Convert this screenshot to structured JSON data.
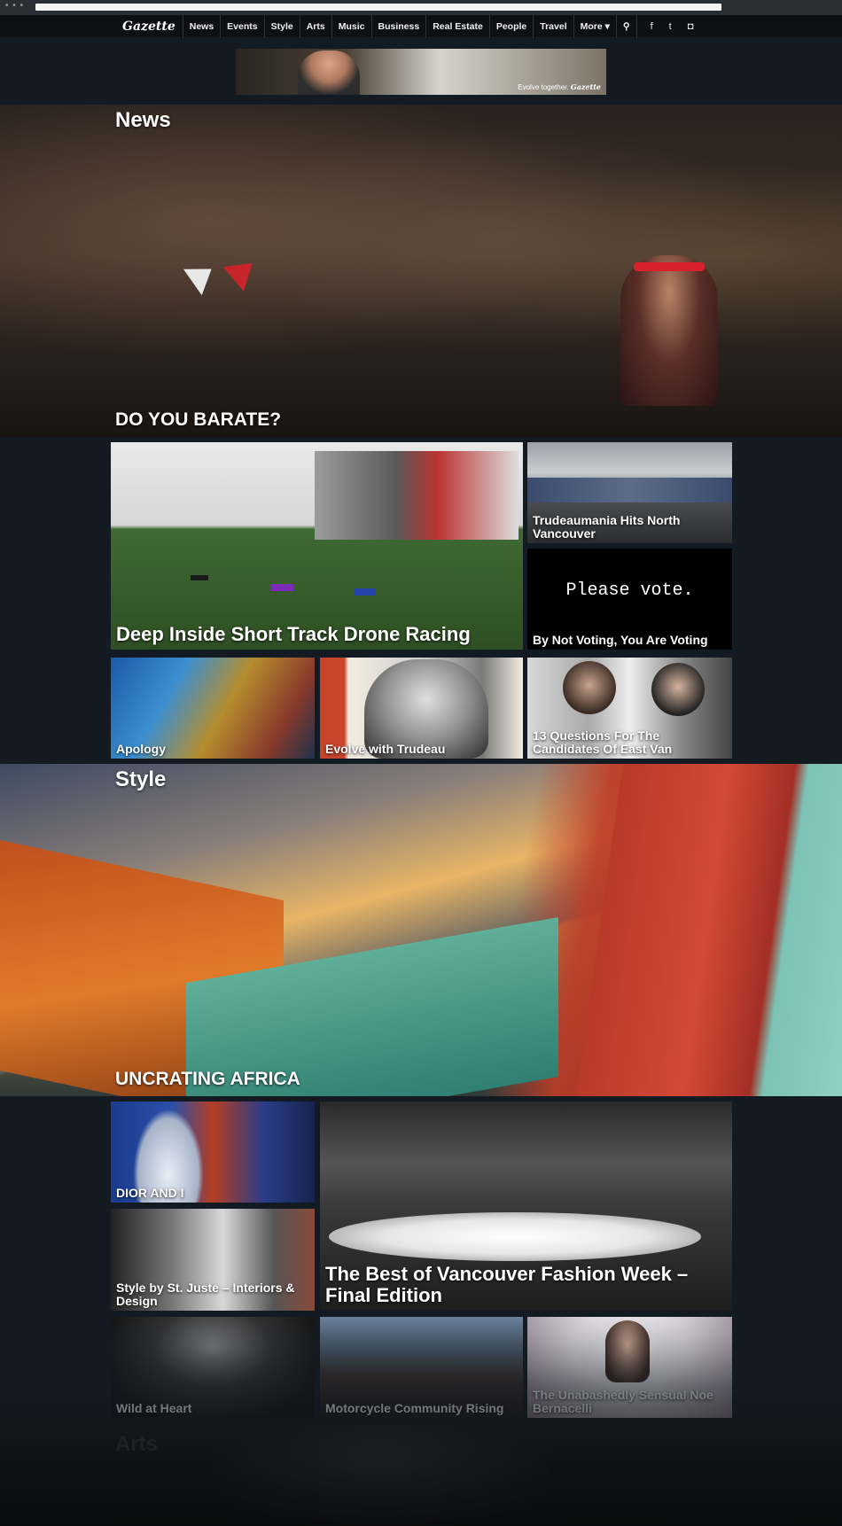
{
  "browser": {
    "dots": "• • •"
  },
  "nav": {
    "logo": "Gazette",
    "items": [
      "News",
      "Events",
      "Style",
      "Arts",
      "Music",
      "Business",
      "Real Estate",
      "People",
      "Travel",
      "More ▾"
    ],
    "search_icon": "⚲",
    "social": [
      "f",
      "t",
      "◘"
    ]
  },
  "ad": {
    "tag_prefix": "Evolve together.",
    "tag_brand": "Gazette"
  },
  "news": {
    "section": "News",
    "headline": "DO YOU BARATE?",
    "tiles": [
      {
        "caption": "Deep Inside Short Track Drone Racing"
      },
      {
        "caption": "Trudeaumania Hits North Vancouver"
      },
      {
        "caption": "By Not Voting, You Are Voting",
        "image_text": "Please vote."
      },
      {
        "caption": "Apology"
      },
      {
        "caption": "Evolve with Trudeau"
      },
      {
        "caption": "13 Questions For The Candidates Of East Van"
      }
    ]
  },
  "style": {
    "section": "Style",
    "headline": "UNCRATING AFRICA",
    "tiles": [
      {
        "caption": "DIOR AND I"
      },
      {
        "caption": "The Best of Vancouver Fashion Week – Final Edition"
      },
      {
        "caption": "Style by St. Juste – Interiors & Design"
      },
      {
        "caption": "Wild at Heart"
      },
      {
        "caption": "Motorcycle Community Rising"
      },
      {
        "caption": "The Unabashedly Sensual Noe Bernacelli"
      }
    ]
  },
  "arts": {
    "section": "Arts"
  }
}
